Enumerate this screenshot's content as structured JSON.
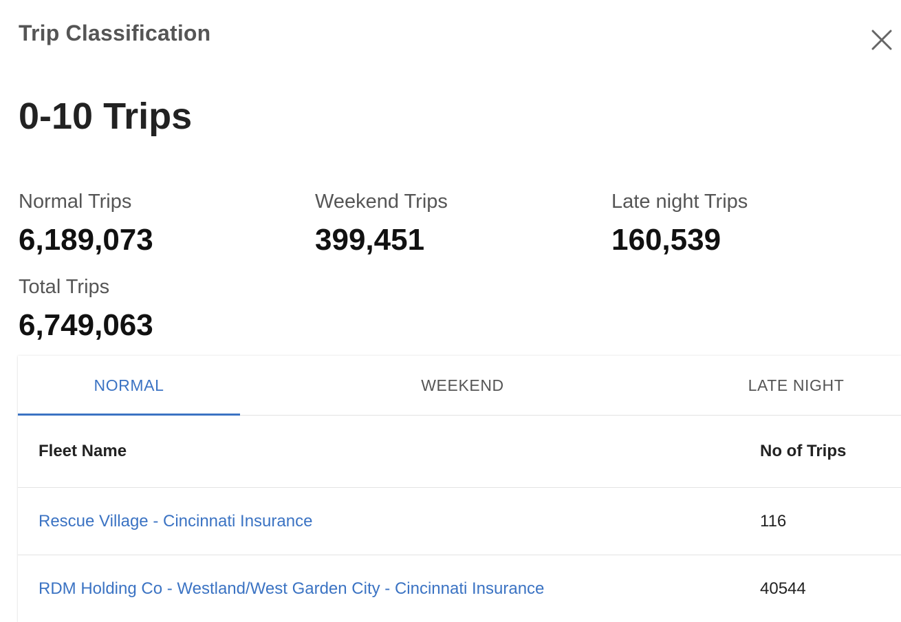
{
  "panel": {
    "title": "Trip Classification",
    "close_icon": "close-icon"
  },
  "range_title": "0-10 Trips",
  "stats": {
    "normal": {
      "label": "Normal Trips",
      "value": "6,189,073"
    },
    "weekend": {
      "label": "Weekend Trips",
      "value": "399,451"
    },
    "late_night": {
      "label": "Late night Trips",
      "value": "160,539"
    },
    "total": {
      "label": "Total Trips",
      "value": "6,749,063"
    }
  },
  "tabs": [
    {
      "label": "NORMAL",
      "active": true
    },
    {
      "label": "WEEKEND",
      "active": false
    },
    {
      "label": "LATE NIGHT",
      "active": false
    }
  ],
  "table": {
    "columns": [
      "Fleet Name",
      "No of Trips"
    ],
    "rows": [
      {
        "fleet": "Rescue Village - Cincinnati Insurance",
        "trips": "116"
      },
      {
        "fleet": "RDM Holding Co - Westland/West Garden City - Cincinnati Insurance",
        "trips": "40544"
      }
    ]
  },
  "colors": {
    "accent": "#3b73c3",
    "muted_text": "#555555",
    "divider": "#e3e3e3"
  }
}
